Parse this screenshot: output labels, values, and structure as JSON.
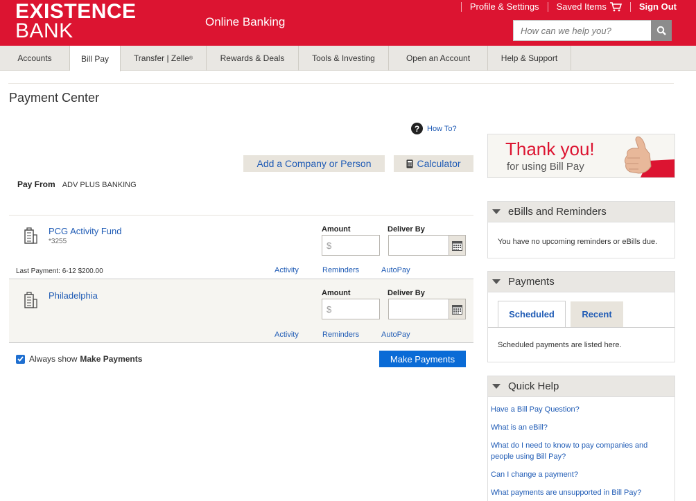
{
  "brand": {
    "line1": "EXISTENCE",
    "line2": "BANK",
    "product": "Online Banking"
  },
  "header_links": {
    "profile": "Profile & Settings",
    "saved": "Saved Items",
    "signout": "Sign Out"
  },
  "search": {
    "placeholder": "How can we help you?"
  },
  "nav": {
    "accounts": "Accounts",
    "billpay": "Bill Pay",
    "transfer": "Transfer | Zelle",
    "transfer_mark": "®",
    "rewards": "Rewards & Deals",
    "tools": "Tools & Investing",
    "open": "Open an Account",
    "help": "Help & Support"
  },
  "page": {
    "title": "Payment Center",
    "how_to": "How To?",
    "add_button": "Add a Company or Person",
    "calc_button": "Calculator"
  },
  "pay_from": {
    "label": "Pay From",
    "account": "ADV PLUS BANKING"
  },
  "payees": [
    {
      "name": "PCG Activity Fund",
      "acct": "*3255",
      "amount_label": "Amount",
      "amount_prefix": "$",
      "deliver_label": "Deliver By",
      "last_payment": "Last Payment: 6-12  $200.00",
      "activity": "Activity",
      "reminders": "Reminders",
      "autopay": "AutoPay"
    },
    {
      "name": "Philadelphia",
      "amount_label": "Amount",
      "amount_prefix": "$",
      "deliver_label": "Deliver By",
      "activity": "Activity",
      "reminders": "Reminders",
      "autopay": "AutoPay"
    }
  ],
  "footer_controls": {
    "always_show": "Always show",
    "always_show_bold": "Make Payments",
    "make_payments": "Make Payments"
  },
  "promo": {
    "line1": "Thank you!",
    "line2": "for using Bill Pay"
  },
  "ebills": {
    "title": "eBills and Reminders",
    "message": "You have no upcoming reminders or eBills due."
  },
  "payments_panel": {
    "title": "Payments",
    "tab_scheduled": "Scheduled",
    "tab_recent": "Recent",
    "message": "Scheduled payments are listed here."
  },
  "quick_help": {
    "title": "Quick Help",
    "links": [
      "Have a Bill Pay Question?",
      "What is an eBill?",
      "What do I need to know to pay companies and people using Bill Pay?",
      "Can I change a payment?",
      "What payments are unsupported in Bill Pay?"
    ]
  },
  "colors": {
    "brand_red": "#dc1431",
    "link_blue": "#1f5bb5",
    "button_blue": "#0a6bd6"
  }
}
